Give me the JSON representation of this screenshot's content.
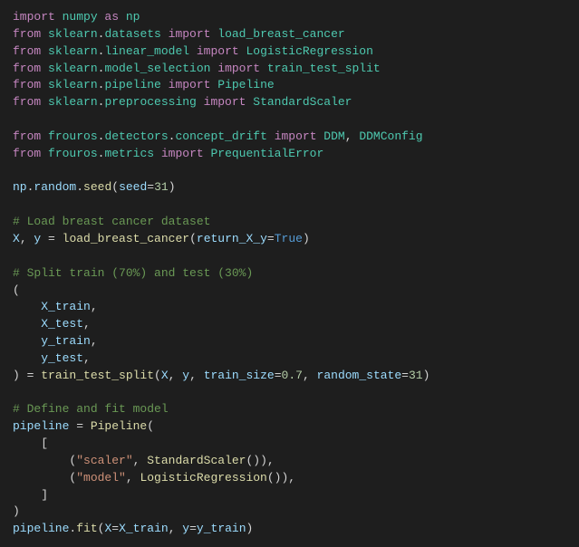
{
  "code": {
    "lines": [
      {
        "tokens": [
          {
            "t": "import ",
            "c": "kw"
          },
          {
            "t": "numpy ",
            "c": "mod"
          },
          {
            "t": "as ",
            "c": "kw"
          },
          {
            "t": "np",
            "c": "mod"
          }
        ]
      },
      {
        "tokens": [
          {
            "t": "from ",
            "c": "kw"
          },
          {
            "t": "sklearn",
            "c": "mod"
          },
          {
            "t": ".",
            "c": "p"
          },
          {
            "t": "datasets ",
            "c": "mod"
          },
          {
            "t": "import ",
            "c": "kw"
          },
          {
            "t": "load_breast_cancer",
            "c": "mod"
          }
        ]
      },
      {
        "tokens": [
          {
            "t": "from ",
            "c": "kw"
          },
          {
            "t": "sklearn",
            "c": "mod"
          },
          {
            "t": ".",
            "c": "p"
          },
          {
            "t": "linear_model ",
            "c": "mod"
          },
          {
            "t": "import ",
            "c": "kw"
          },
          {
            "t": "LogisticRegression",
            "c": "mod"
          }
        ]
      },
      {
        "tokens": [
          {
            "t": "from ",
            "c": "kw"
          },
          {
            "t": "sklearn",
            "c": "mod"
          },
          {
            "t": ".",
            "c": "p"
          },
          {
            "t": "model_selection ",
            "c": "mod"
          },
          {
            "t": "import ",
            "c": "kw"
          },
          {
            "t": "train_test_split",
            "c": "mod"
          }
        ]
      },
      {
        "tokens": [
          {
            "t": "from ",
            "c": "kw"
          },
          {
            "t": "sklearn",
            "c": "mod"
          },
          {
            "t": ".",
            "c": "p"
          },
          {
            "t": "pipeline ",
            "c": "mod"
          },
          {
            "t": "import ",
            "c": "kw"
          },
          {
            "t": "Pipeline",
            "c": "mod"
          }
        ]
      },
      {
        "tokens": [
          {
            "t": "from ",
            "c": "kw"
          },
          {
            "t": "sklearn",
            "c": "mod"
          },
          {
            "t": ".",
            "c": "p"
          },
          {
            "t": "preprocessing ",
            "c": "mod"
          },
          {
            "t": "import ",
            "c": "kw"
          },
          {
            "t": "StandardScaler",
            "c": "mod"
          }
        ]
      },
      {
        "tokens": []
      },
      {
        "tokens": [
          {
            "t": "from ",
            "c": "kw"
          },
          {
            "t": "frouros",
            "c": "mod"
          },
          {
            "t": ".",
            "c": "p"
          },
          {
            "t": "detectors",
            "c": "mod"
          },
          {
            "t": ".",
            "c": "p"
          },
          {
            "t": "concept_drift ",
            "c": "mod"
          },
          {
            "t": "import ",
            "c": "kw"
          },
          {
            "t": "DDM",
            "c": "mod"
          },
          {
            "t": ", ",
            "c": "p"
          },
          {
            "t": "DDMConfig",
            "c": "mod"
          }
        ]
      },
      {
        "tokens": [
          {
            "t": "from ",
            "c": "kw"
          },
          {
            "t": "frouros",
            "c": "mod"
          },
          {
            "t": ".",
            "c": "p"
          },
          {
            "t": "metrics ",
            "c": "mod"
          },
          {
            "t": "import ",
            "c": "kw"
          },
          {
            "t": "PrequentialError",
            "c": "mod"
          }
        ]
      },
      {
        "tokens": []
      },
      {
        "tokens": [
          {
            "t": "np",
            "c": "id"
          },
          {
            "t": ".",
            "c": "p"
          },
          {
            "t": "random",
            "c": "id"
          },
          {
            "t": ".",
            "c": "p"
          },
          {
            "t": "seed",
            "c": "fn"
          },
          {
            "t": "(",
            "c": "p"
          },
          {
            "t": "seed",
            "c": "id"
          },
          {
            "t": "=",
            "c": "op"
          },
          {
            "t": "31",
            "c": "num"
          },
          {
            "t": ")",
            "c": "p"
          }
        ]
      },
      {
        "tokens": []
      },
      {
        "tokens": [
          {
            "t": "# Load breast cancer dataset",
            "c": "cmt"
          }
        ]
      },
      {
        "tokens": [
          {
            "t": "X",
            "c": "id"
          },
          {
            "t": ", ",
            "c": "p"
          },
          {
            "t": "y ",
            "c": "id"
          },
          {
            "t": "= ",
            "c": "op"
          },
          {
            "t": "load_breast_cancer",
            "c": "fn"
          },
          {
            "t": "(",
            "c": "p"
          },
          {
            "t": "return_X_y",
            "c": "id"
          },
          {
            "t": "=",
            "c": "op"
          },
          {
            "t": "True",
            "c": "bool"
          },
          {
            "t": ")",
            "c": "p"
          }
        ]
      },
      {
        "tokens": []
      },
      {
        "tokens": [
          {
            "t": "# Split train (70%) and test (30%)",
            "c": "cmt"
          }
        ]
      },
      {
        "tokens": [
          {
            "t": "(",
            "c": "p"
          }
        ]
      },
      {
        "tokens": [
          {
            "t": "    X_train",
            "c": "id"
          },
          {
            "t": ",",
            "c": "p"
          }
        ]
      },
      {
        "tokens": [
          {
            "t": "    X_test",
            "c": "id"
          },
          {
            "t": ",",
            "c": "p"
          }
        ]
      },
      {
        "tokens": [
          {
            "t": "    y_train",
            "c": "id"
          },
          {
            "t": ",",
            "c": "p"
          }
        ]
      },
      {
        "tokens": [
          {
            "t": "    y_test",
            "c": "id"
          },
          {
            "t": ",",
            "c": "p"
          }
        ]
      },
      {
        "tokens": [
          {
            "t": ") ",
            "c": "p"
          },
          {
            "t": "= ",
            "c": "op"
          },
          {
            "t": "train_test_split",
            "c": "fn"
          },
          {
            "t": "(",
            "c": "p"
          },
          {
            "t": "X",
            "c": "id"
          },
          {
            "t": ", ",
            "c": "p"
          },
          {
            "t": "y",
            "c": "id"
          },
          {
            "t": ", ",
            "c": "p"
          },
          {
            "t": "train_size",
            "c": "id"
          },
          {
            "t": "=",
            "c": "op"
          },
          {
            "t": "0.7",
            "c": "num"
          },
          {
            "t": ", ",
            "c": "p"
          },
          {
            "t": "random_state",
            "c": "id"
          },
          {
            "t": "=",
            "c": "op"
          },
          {
            "t": "31",
            "c": "num"
          },
          {
            "t": ")",
            "c": "p"
          }
        ]
      },
      {
        "tokens": []
      },
      {
        "tokens": [
          {
            "t": "# Define and fit model",
            "c": "cmt"
          }
        ]
      },
      {
        "tokens": [
          {
            "t": "pipeline ",
            "c": "id"
          },
          {
            "t": "= ",
            "c": "op"
          },
          {
            "t": "Pipeline",
            "c": "fn"
          },
          {
            "t": "(",
            "c": "p"
          }
        ]
      },
      {
        "tokens": [
          {
            "t": "    [",
            "c": "p"
          }
        ]
      },
      {
        "tokens": [
          {
            "t": "        (",
            "c": "p"
          },
          {
            "t": "\"scaler\"",
            "c": "str"
          },
          {
            "t": ", ",
            "c": "p"
          },
          {
            "t": "StandardScaler",
            "c": "fn"
          },
          {
            "t": "()),",
            "c": "p"
          }
        ]
      },
      {
        "tokens": [
          {
            "t": "        (",
            "c": "p"
          },
          {
            "t": "\"model\"",
            "c": "str"
          },
          {
            "t": ", ",
            "c": "p"
          },
          {
            "t": "LogisticRegression",
            "c": "fn"
          },
          {
            "t": "()),",
            "c": "p"
          }
        ]
      },
      {
        "tokens": [
          {
            "t": "    ]",
            "c": "p"
          }
        ]
      },
      {
        "tokens": [
          {
            "t": ")",
            "c": "p"
          }
        ]
      },
      {
        "tokens": [
          {
            "t": "pipeline",
            "c": "id"
          },
          {
            "t": ".",
            "c": "p"
          },
          {
            "t": "fit",
            "c": "fn"
          },
          {
            "t": "(",
            "c": "p"
          },
          {
            "t": "X",
            "c": "id"
          },
          {
            "t": "=",
            "c": "op"
          },
          {
            "t": "X_train",
            "c": "id"
          },
          {
            "t": ", ",
            "c": "p"
          },
          {
            "t": "y",
            "c": "id"
          },
          {
            "t": "=",
            "c": "op"
          },
          {
            "t": "y_train",
            "c": "id"
          },
          {
            "t": ")",
            "c": "p"
          }
        ]
      }
    ]
  }
}
